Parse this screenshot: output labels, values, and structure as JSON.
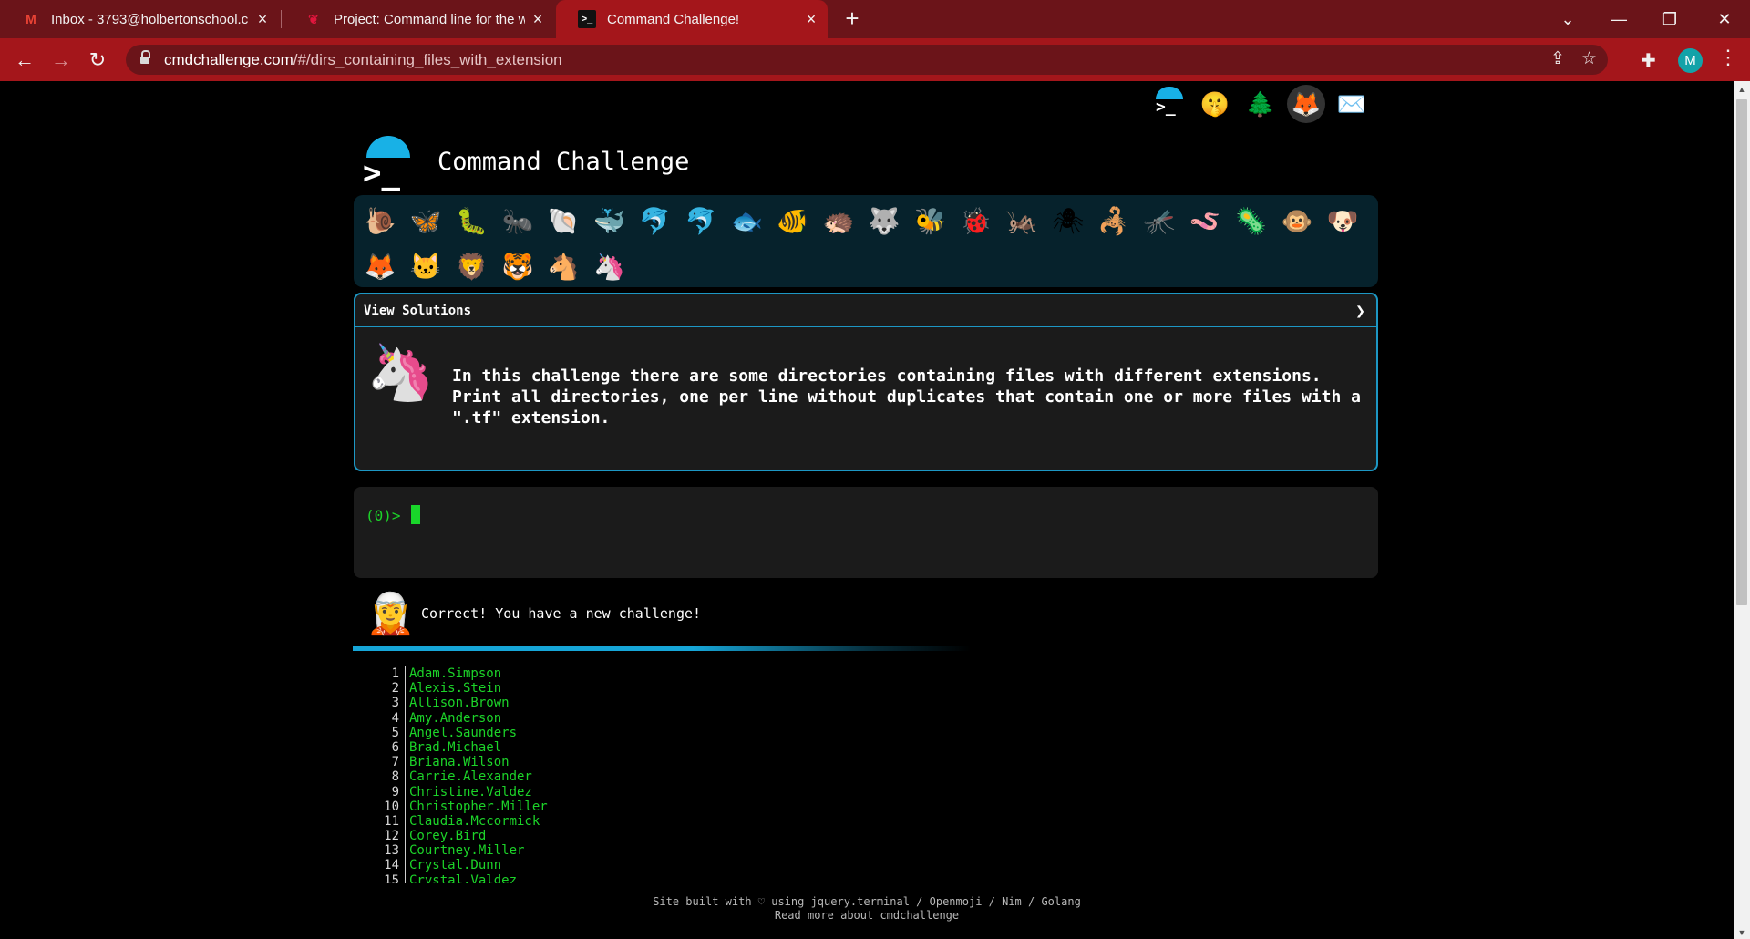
{
  "browser": {
    "tabs": [
      {
        "title": "Inbox - 3793@holbertonschool.c",
        "icon": "gmail-icon",
        "active": false
      },
      {
        "title": "Project: Command line for the wi",
        "icon": "holberton-icon",
        "active": false
      },
      {
        "title": "Command Challenge!",
        "icon": "terminal-icon",
        "active": true
      }
    ],
    "url_host": "cmdchallenge.com",
    "url_path": "/#/dirs_containing_files_with_extension",
    "profile_initial": "M",
    "accent_color": "#a4161b"
  },
  "page": {
    "title": "Command Challenge",
    "header_icons": [
      "terminal-icon",
      "shushing-face-icon",
      "tree-icon",
      "gitlab-icon",
      "envelope-icon"
    ],
    "animals": [
      "🐌",
      "🦋",
      "🐛",
      "🐜",
      "🐚",
      "🐳",
      "🐬",
      "🐬",
      "🐟",
      "🐠",
      "🦔",
      "🐺",
      "🐝",
      "🐞",
      "🦗",
      "🕷",
      "🦂",
      "🦟",
      "🪱",
      "🦠",
      "🐵",
      "🐶",
      "🦊",
      "🐱",
      "🦁",
      "🐯",
      "🐴",
      "🦄"
    ],
    "solutions_label": "View Solutions",
    "challenge_text": "In this challenge there are some directories containing files with different extensions. Print all directories, one per line without duplicates that contain one or more files with a \".tf\" extension.",
    "prompt": "(0)>",
    "feedback": "Correct! You have a new challenge!",
    "output_lines": [
      "Adam.Simpson",
      "Alexis.Stein",
      "Allison.Brown",
      "Amy.Anderson",
      "Angel.Saunders",
      "Brad.Michael",
      "Briana.Wilson",
      "Carrie.Alexander",
      "Christine.Valdez",
      "Christopher.Miller",
      "Claudia.Mccormick",
      "Corey.Bird",
      "Courtney.Miller",
      "Crystal.Dunn",
      "Crystal.Valdez"
    ],
    "footer_line1": "Site built with ♡ using jquery.terminal / Openmoji / Nim / Golang",
    "footer_line2": "Read more about cmdchallenge"
  }
}
